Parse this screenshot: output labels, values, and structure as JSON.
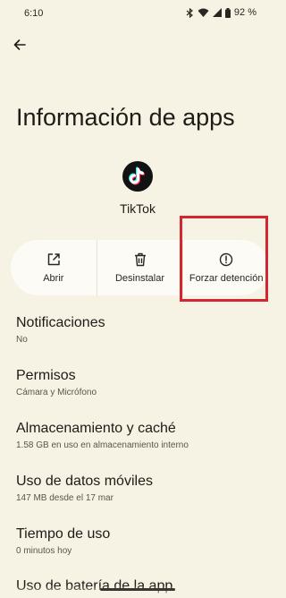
{
  "status": {
    "time": "6:10",
    "battery": "92 %"
  },
  "page": {
    "title": "Información de apps"
  },
  "app": {
    "name": "TikTok"
  },
  "actions": [
    {
      "label": "Abrir",
      "icon": "open-external-icon"
    },
    {
      "label": "Desinstalar",
      "icon": "trash-icon"
    },
    {
      "label": "Forzar detención",
      "icon": "alert-circle-icon"
    }
  ],
  "settings": [
    {
      "title": "Notificaciones",
      "subtitle": "No"
    },
    {
      "title": "Permisos",
      "subtitle": "Cámara y Micrófono"
    },
    {
      "title": "Almacenamiento y caché",
      "subtitle": "1.58 GB en uso en almacenamiento interno"
    },
    {
      "title": "Uso de datos móviles",
      "subtitle": "147 MB desde el 17 mar"
    },
    {
      "title": "Tiempo de uso",
      "subtitle": "0 minutos hoy"
    },
    {
      "title": "Uso de batería de la app"
    }
  ],
  "colors": {
    "background": "#f6f2e4",
    "card": "#fdfbf6",
    "highlight": "#d32630"
  }
}
